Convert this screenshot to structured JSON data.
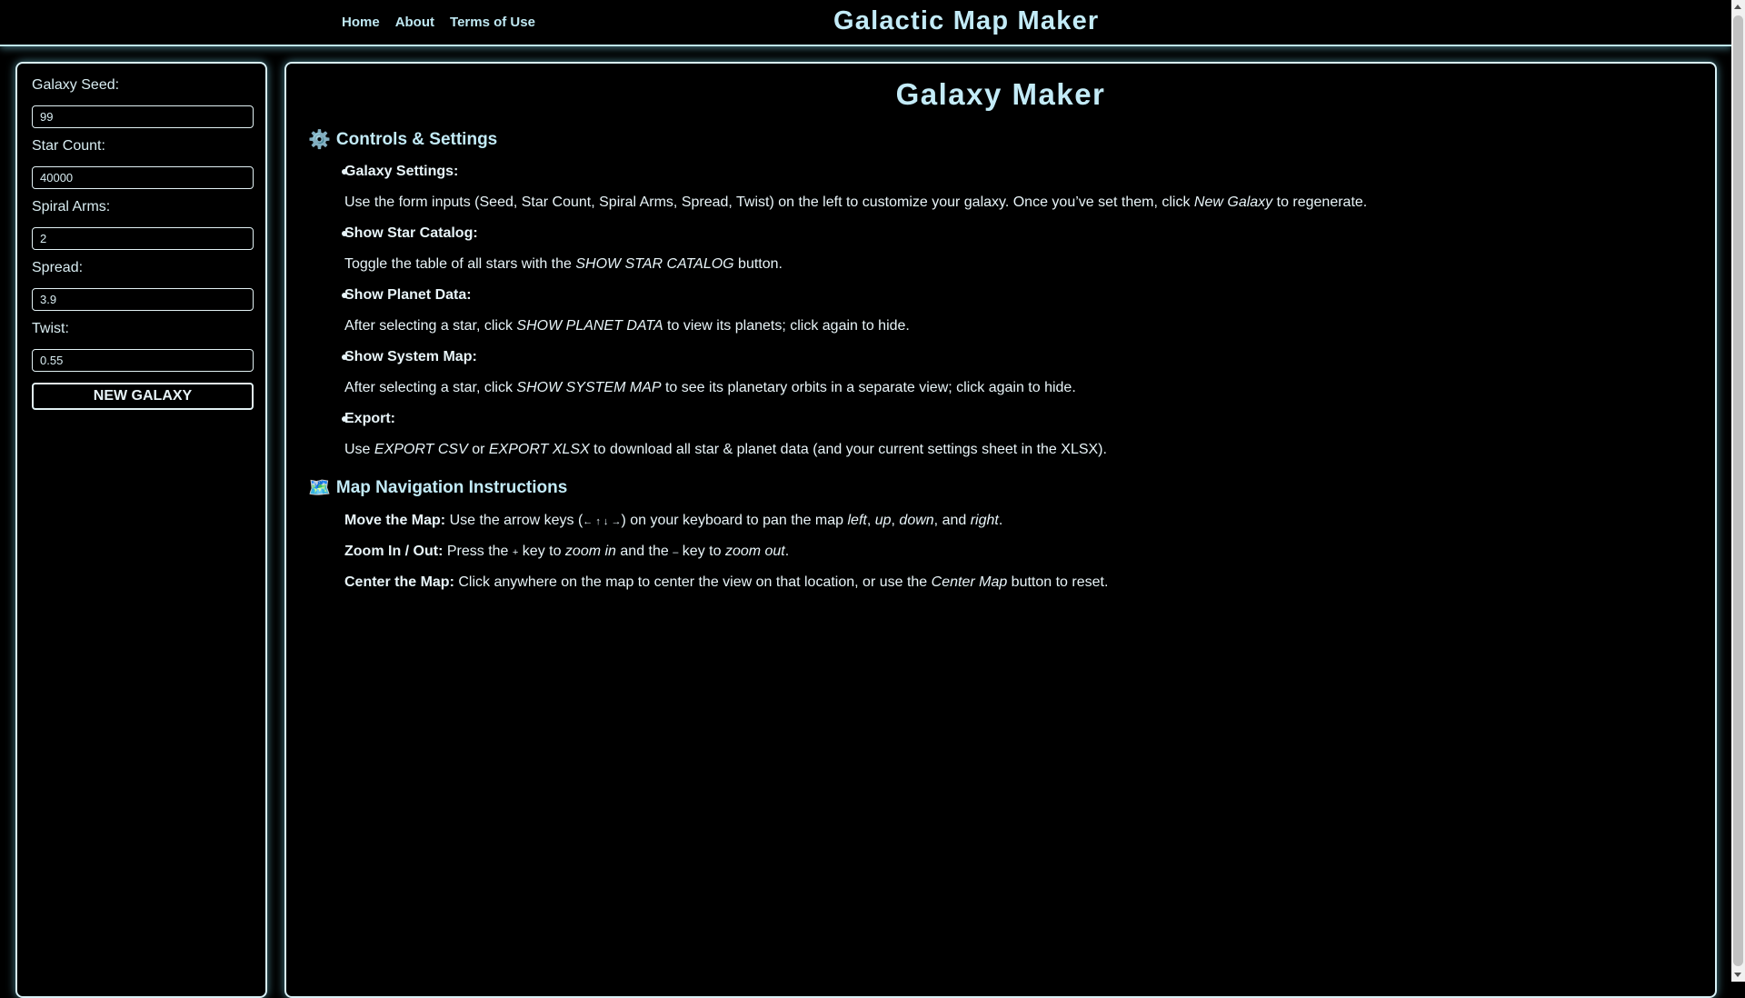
{
  "nav": [
    "Home",
    "About",
    "Terms of Use"
  ],
  "site_title": "Galactic Map Maker",
  "form": {
    "seed_label": "Galaxy Seed:",
    "seed_value": "99",
    "stars_label": "Star Count:",
    "stars_value": "40000",
    "arms_label": "Spiral Arms:",
    "arms_value": "2",
    "spread_label": "Spread:",
    "spread_value": "3.9",
    "twist_label": "Twist:",
    "twist_value": "0.55",
    "button": "NEW GALAXY"
  },
  "main": {
    "title": "Galaxy Maker",
    "controls_heading": "Controls & Settings",
    "controls_icon": "⚙️",
    "items": [
      {
        "title": "Galaxy Settings:",
        "desc_before": "Use the form inputs (Seed, Star Count, Spiral Arms, Spread, Twist) on the left to customize your galaxy. Once you’ve set them, click ",
        "desc_em": "New Galaxy",
        "desc_after": " to regenerate."
      },
      {
        "title": "Show Star Catalog:",
        "desc_before": "Toggle the table of all stars with the ",
        "desc_em": "SHOW STAR CATALOG",
        "desc_after": " button."
      },
      {
        "title": "Show Planet Data:",
        "desc_before": "After selecting a star, click ",
        "desc_em": "SHOW PLANET DATA",
        "desc_after": " to view its planets; click again to hide."
      },
      {
        "title": "Show System Map:",
        "desc_before": "After selecting a star, click ",
        "desc_em": "SHOW SYSTEM MAP",
        "desc_after": " to see its planetary orbits in a separate view; click again to hide."
      },
      {
        "title": "Export:",
        "desc_before": "Use ",
        "desc_em": "EXPORT CSV",
        "desc_mid": " or ",
        "desc_em2": "EXPORT XLSX",
        "desc_after": " to download all star & planet data (and your current settings sheet in the XLSX)."
      }
    ],
    "nav_heading": "Map Navigation Instructions",
    "nav_icon": "🗺️",
    "move": {
      "label": "Move the Map:",
      "a": " Use the arrow keys (",
      "keys": "← ↑ ↓ →",
      "b": ") on your keyboard to pan the map ",
      "left": "left",
      "c": ", ",
      "up": "up",
      "d": ", ",
      "down": "down",
      "e": ", and ",
      "right": "right",
      "f": "."
    },
    "zoom": {
      "label": "Zoom In / Out:",
      "a": " Press the ",
      "plus": "+",
      "b": " key to ",
      "zin": "zoom in",
      "c": " and the ",
      "minus": "–",
      "d": " key to ",
      "zout": "zoom out",
      "e": "."
    },
    "center": {
      "label": "Center the Map:",
      "a": " Click anywhere on the map to center the view on that location, or use the ",
      "em": "Center Map",
      "b": " button to reset."
    }
  }
}
